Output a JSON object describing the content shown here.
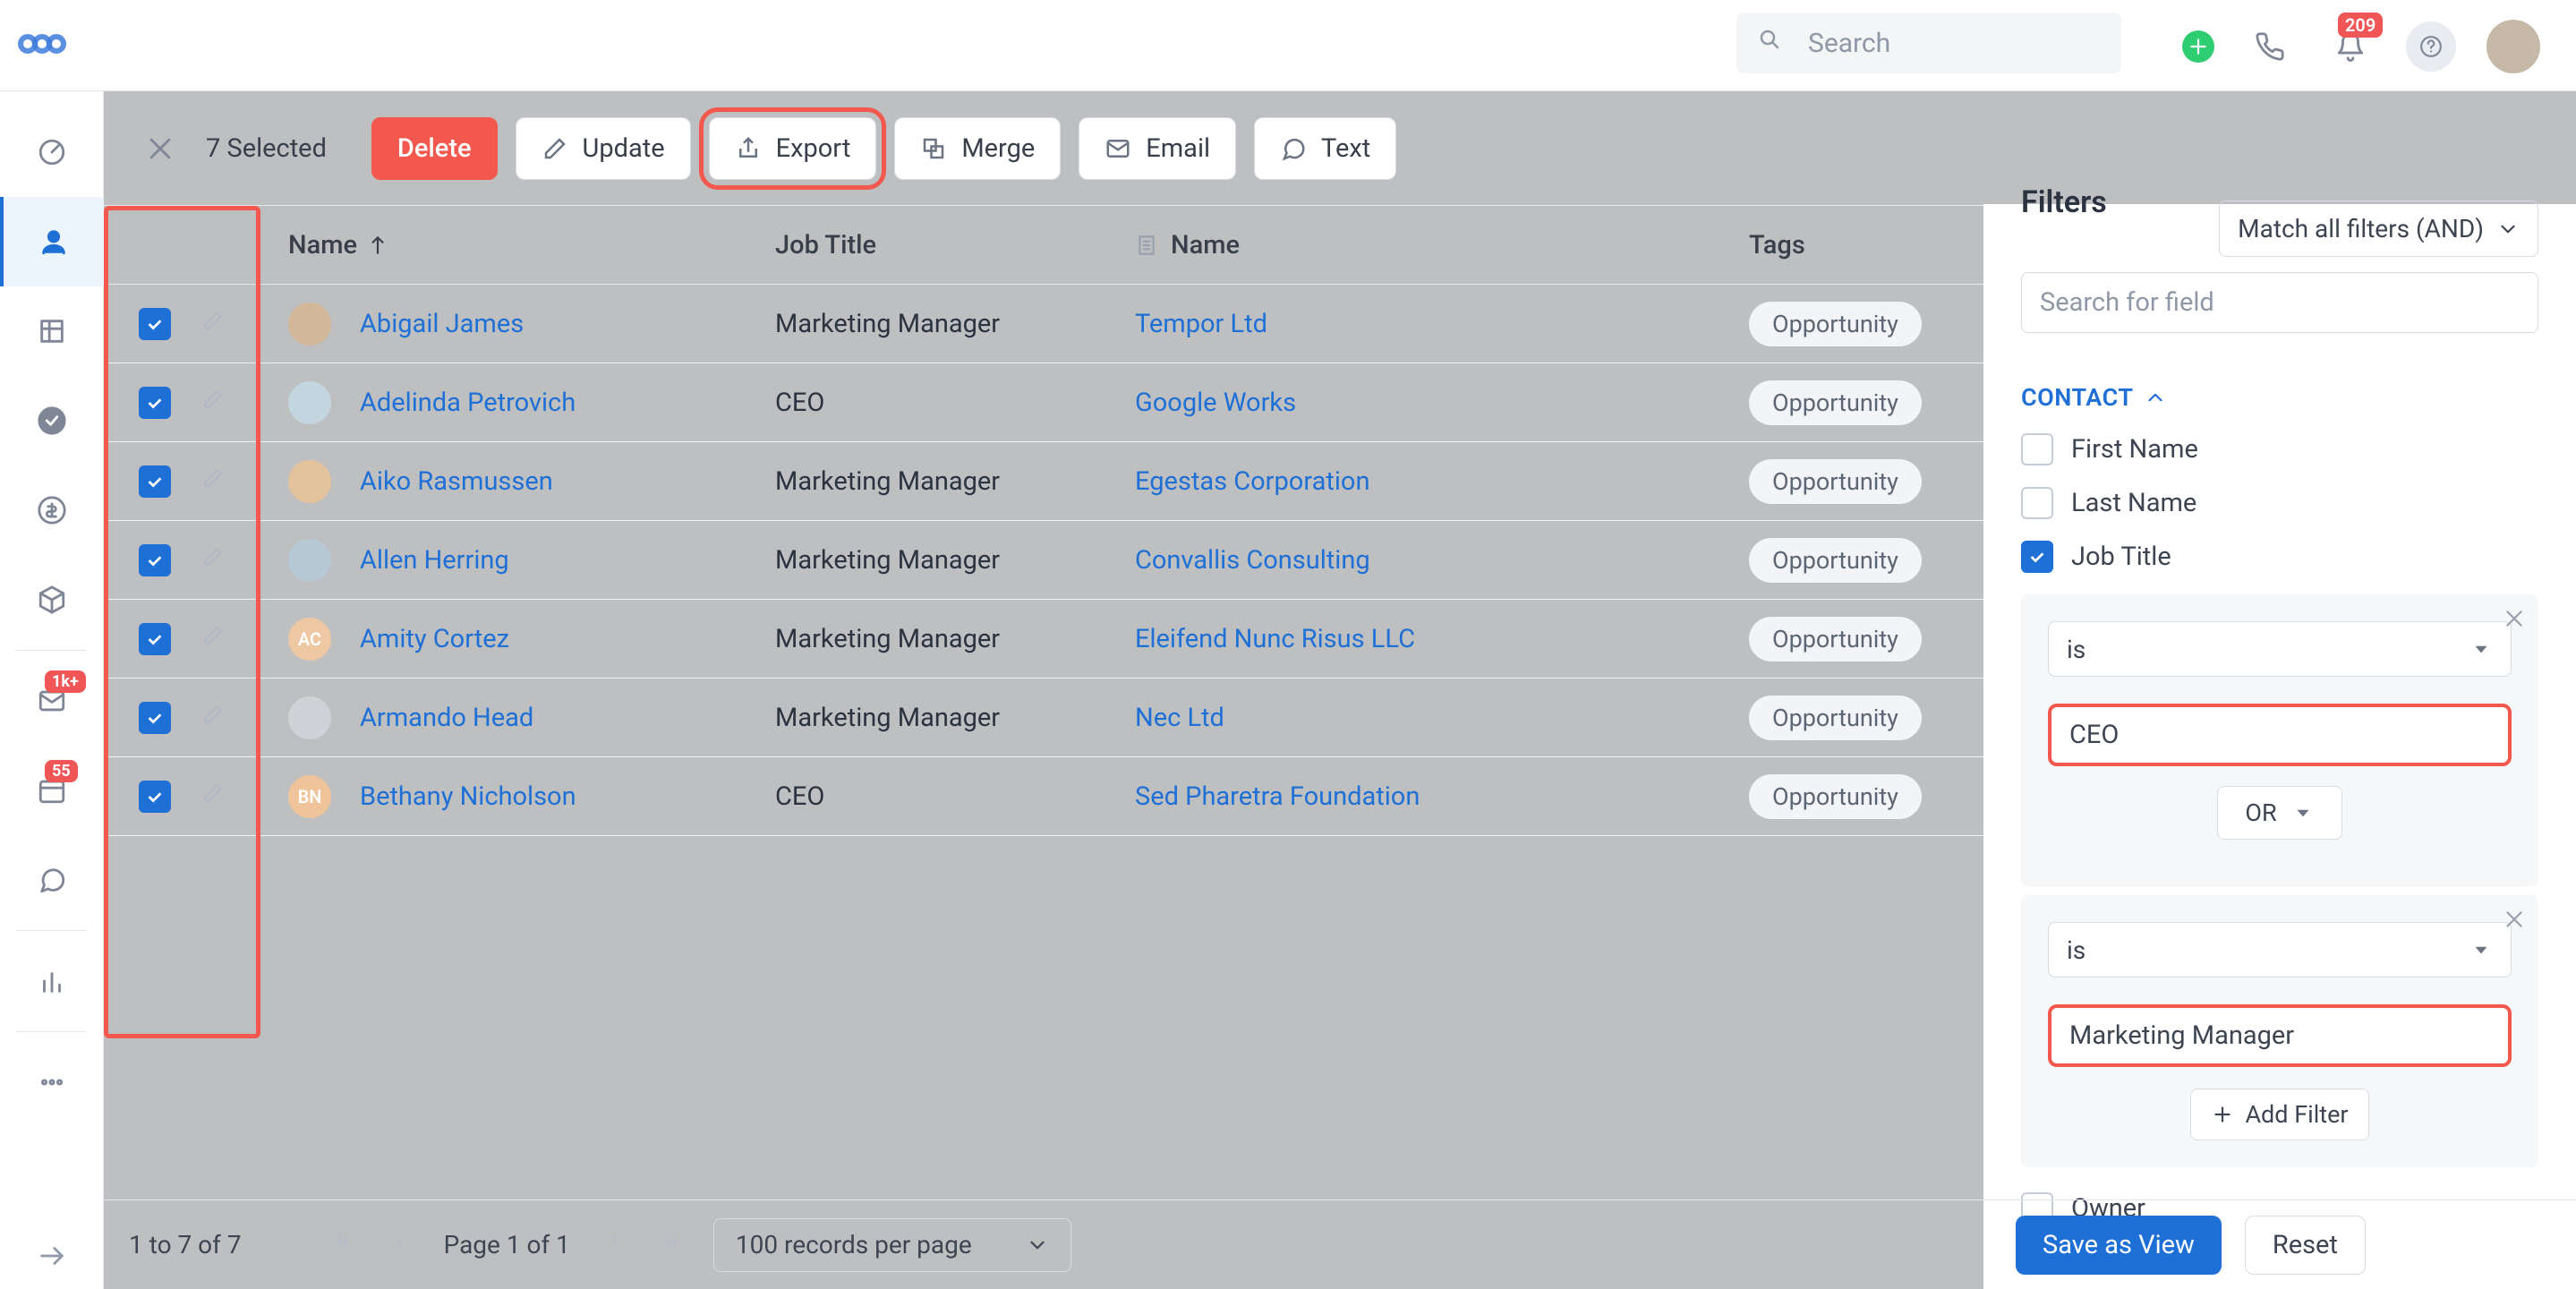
{
  "header": {
    "search_placeholder": "Search",
    "notif_count": "209"
  },
  "rail": {
    "inbox_badge": "1k+",
    "second_badge": "55"
  },
  "toolbar": {
    "selected_text": "7 Selected",
    "delete": "Delete",
    "update": "Update",
    "export": "Export",
    "merge": "Merge",
    "email": "Email",
    "text": "Text"
  },
  "columns": {
    "name": "Name",
    "job": "Job Title",
    "org": "Name",
    "tags": "Tags"
  },
  "rows": [
    {
      "name": "Abigail James",
      "job": "Marketing Manager",
      "org": "Tempor Ltd",
      "tag": "Opportunity",
      "initials": ""
    },
    {
      "name": "Adelinda Petrovich",
      "job": "CEO",
      "org": "Google Works",
      "tag": "Opportunity",
      "initials": ""
    },
    {
      "name": "Aiko Rasmussen",
      "job": "Marketing Manager",
      "org": "Egestas Corporation",
      "tag": "Opportunity",
      "initials": ""
    },
    {
      "name": "Allen Herring",
      "job": "Marketing Manager",
      "org": "Convallis Consulting",
      "tag": "Opportunity",
      "initials": ""
    },
    {
      "name": "Amity Cortez",
      "job": "Marketing Manager",
      "org": "Eleifend Nunc Risus LLC",
      "tag": "Opportunity",
      "initials": "AC"
    },
    {
      "name": "Armando Head",
      "job": "Marketing Manager",
      "org": "Nec Ltd",
      "tag": "Opportunity",
      "initials": ""
    },
    {
      "name": "Bethany Nicholson",
      "job": "CEO",
      "org": "Sed Pharetra Foundation",
      "tag": "Opportunity",
      "initials": "BN"
    }
  ],
  "footer": {
    "range": "1 to 7 of 7",
    "page": "Page 1 of 1",
    "perpage": "100 records per page"
  },
  "drawer": {
    "title": "Filters",
    "match": "Match all filters (AND)",
    "search_placeholder": "Search for field",
    "section": "CONTACT",
    "first": "First Name",
    "last": "Last Name",
    "job": "Job Title",
    "operator": "is",
    "value1": "CEO",
    "or": "OR",
    "value2": "Marketing Manager",
    "addfilter": "Add Filter",
    "owner": "Owner",
    "save": "Save as View",
    "reset": "Reset"
  }
}
